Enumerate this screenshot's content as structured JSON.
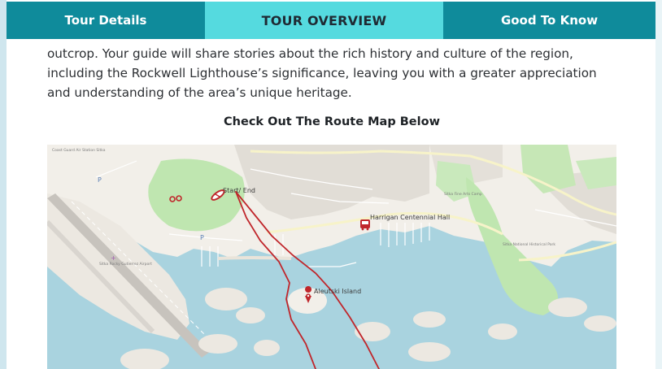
{
  "tabs": [
    {
      "label": "Tour Details"
    },
    {
      "label": "TOUR OVERVIEW"
    },
    {
      "label": "Good To Know"
    }
  ],
  "content": {
    "text_line1": "outcrop. Your guide will share stories about the rich history and culture of the region,",
    "text_line2": "including the Rockwell Lighthouse’s significance, leaving you with a greater appreciation",
    "text_line3": "and understanding of the area’s unique heritage.",
    "map_heading": "Check Out The Route Map Below"
  },
  "map": {
    "start_label": "Start/ End",
    "hall_label": "Harrigan Centennial Hall",
    "island_label": "Aleutski Island",
    "small_labels": {
      "coast_guard": "Coast Guard Air Station Sitka",
      "sitka_fine_arts": "Sitka Fine Arts Camp",
      "historical_park": "Sitka National Historical Park",
      "sitka_rocky": "Sitka Rocky Gutierrez Airport"
    },
    "colors": {
      "water": "#a9d3df",
      "land": "#f2efe9",
      "park": "#bfe6b0",
      "route": "#c0262b"
    }
  }
}
